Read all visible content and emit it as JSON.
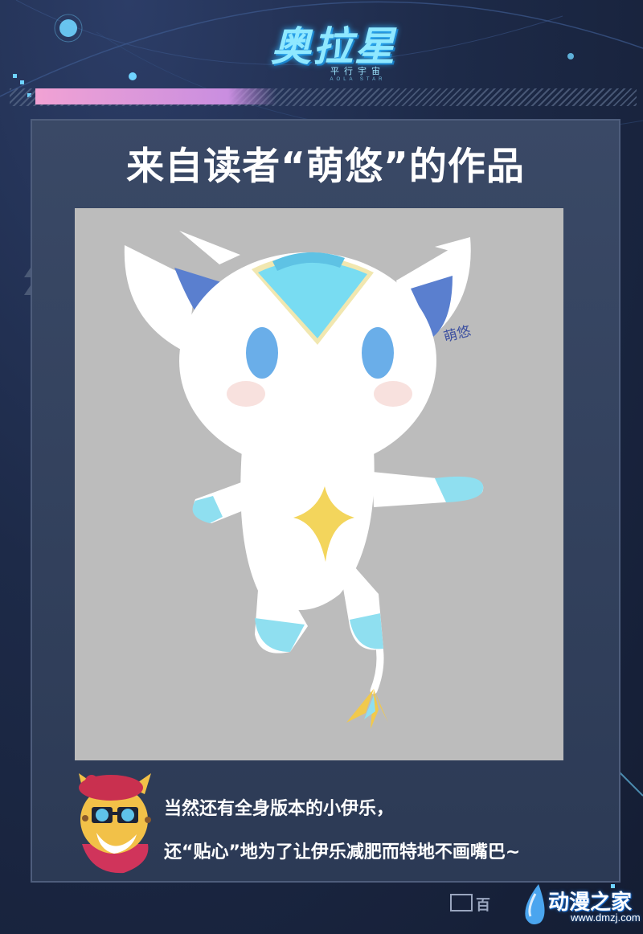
{
  "logo": {
    "main": "奥拉星",
    "sub": "平行宇宙",
    "tiny": "AOLA STAR"
  },
  "card": {
    "title": "来自读者“萌悠”的作品"
  },
  "artwork": {
    "signature": "萌悠",
    "background_color": "#bcbcbc",
    "creature_color": "#ffffff",
    "ear_color": "#5a7fcf",
    "eye_color": "#6aaee9",
    "crest_color": "#78dcf2",
    "star_color": "#f3d55c"
  },
  "caption": {
    "line1": "当然还有全身版本的小伊乐，",
    "line2": "还“贴心”地为了让伊乐减肥而特地不画嘴巴~"
  },
  "footer": {
    "brand": "百"
  },
  "watermark": {
    "text": "动漫之家",
    "url": "www.dmzj.com"
  },
  "colors": {
    "accent_pink": "#f1a2d4",
    "card_bg": "#34435f",
    "title_text": "#ffffff"
  }
}
